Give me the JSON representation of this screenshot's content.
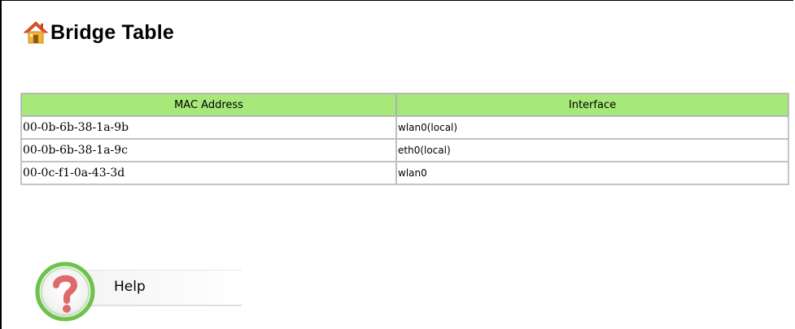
{
  "page": {
    "title": "Bridge Table"
  },
  "table": {
    "headers": {
      "mac": "MAC Address",
      "interface": "Interface"
    },
    "rows": [
      {
        "mac": "00-0b-6b-38-1a-9b",
        "interface": "wlan0(local)"
      },
      {
        "mac": "00-0b-6b-38-1a-9c",
        "interface": "eth0(local)"
      },
      {
        "mac": "00-0c-f1-0a-43-3d",
        "interface": "wlan0"
      }
    ]
  },
  "help": {
    "label": "Help"
  },
  "icons": {
    "title_icon": "home-icon",
    "help_icon": "question-mark-icon"
  },
  "colors": {
    "header_bg": "#a6e87a",
    "help_ring": "#6cc24a",
    "help_question": "#e06a6a",
    "home_roof": "#e4572e",
    "home_body": "#f2b233"
  }
}
